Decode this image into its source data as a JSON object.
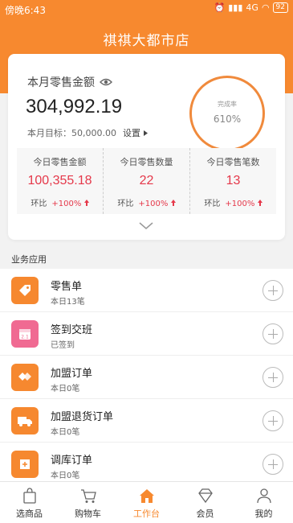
{
  "status_bar": {
    "time": "傍晚6:43",
    "network": "4G",
    "battery": "92"
  },
  "store_title": "祺祺大都市店",
  "summary": {
    "label": "本月零售金额",
    "amount": "304,992.19",
    "target": "本月目标：50,000.00",
    "setting": "设置",
    "completion_label": "完成率",
    "completion_value": "610%"
  },
  "stats": [
    {
      "title": "今日零售金额",
      "value": "100,355.18",
      "compare_label": "环比",
      "compare_value": "+100%"
    },
    {
      "title": "今日零售数量",
      "value": "22",
      "compare_label": "环比",
      "compare_value": "+100%"
    },
    {
      "title": "今日零售笔数",
      "value": "13",
      "compare_label": "环比",
      "compare_value": "+100%"
    }
  ],
  "section_title": "业务应用",
  "apps": [
    {
      "name": "零售单",
      "sub": "本日13笔",
      "icon": "tag-icon",
      "color": "#f6882f"
    },
    {
      "name": "签到交班",
      "sub": "已签到",
      "icon": "calendar-icon",
      "color": "#f06a92"
    },
    {
      "name": "加盟订单",
      "sub": "本日0笔",
      "icon": "handshake-icon",
      "color": "#f6882f"
    },
    {
      "name": "加盟退货订单",
      "sub": "本日0笔",
      "icon": "truck-icon",
      "color": "#f6882f"
    },
    {
      "name": "调库订单",
      "sub": "本日0笔",
      "icon": "box-icon",
      "color": "#f6882f"
    }
  ],
  "tabs": [
    {
      "label": "选商品",
      "icon": "bag-icon"
    },
    {
      "label": "购物车",
      "icon": "cart-icon"
    },
    {
      "label": "工作台",
      "icon": "home-icon"
    },
    {
      "label": "会员",
      "icon": "diamond-icon"
    },
    {
      "label": "我的",
      "icon": "person-icon"
    }
  ],
  "accent_color": "#f7892f",
  "highlight_color": "#e5384a"
}
